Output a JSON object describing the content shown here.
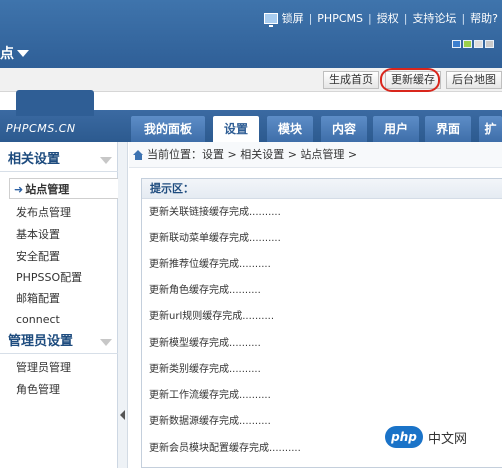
{
  "header": {
    "site_title": "点",
    "links": [
      "锁屏",
      "PHPCMS",
      "授权",
      "支持论坛",
      "帮助?"
    ],
    "swatch_colors": [
      "#3b7fcf",
      "#9bd14a",
      "#dddddd",
      "#c9c9c9"
    ]
  },
  "toolbar": {
    "buttons": [
      "生成首页",
      "更新缓存",
      "后台地图"
    ]
  },
  "logo": {
    "text": "PHPCMS.CN"
  },
  "tabs": [
    "我的面板",
    "设置",
    "模块",
    "内容",
    "用户",
    "界面",
    "扩"
  ],
  "active_tab": "设置",
  "sidebar": {
    "section1_title": "相关设置",
    "section1_items": [
      "站点管理",
      "发布点管理",
      "基本设置",
      "安全配置",
      "PHPSSO配置",
      "邮箱配置",
      "connect"
    ],
    "section2_title": "管理员设置",
    "section2_items": [
      "管理员管理",
      "角色管理"
    ]
  },
  "breadcrumb": {
    "text": "当前位置：设置 > 相关设置 > 站点管理 >"
  },
  "notice": {
    "title": "提示区：",
    "messages": [
      "更新关联链接缓存完成..........",
      "更新联动菜单缓存完成..........",
      "更新推荐位缓存完成..........",
      "更新角色缓存完成..........",
      "更新url规则缓存完成..........",
      "更新模型缓存完成..........",
      "更新类别缓存完成..........",
      "更新工作流缓存完成..........",
      "更新数据源缓存完成..........",
      "更新会员模块配置缓存完成.........."
    ]
  },
  "watermark": {
    "logo": "php",
    "text": "中文网"
  },
  "colors": {
    "header": "#2f5f97",
    "highlight": "#d9261c",
    "accent": "#1d4b7e"
  }
}
